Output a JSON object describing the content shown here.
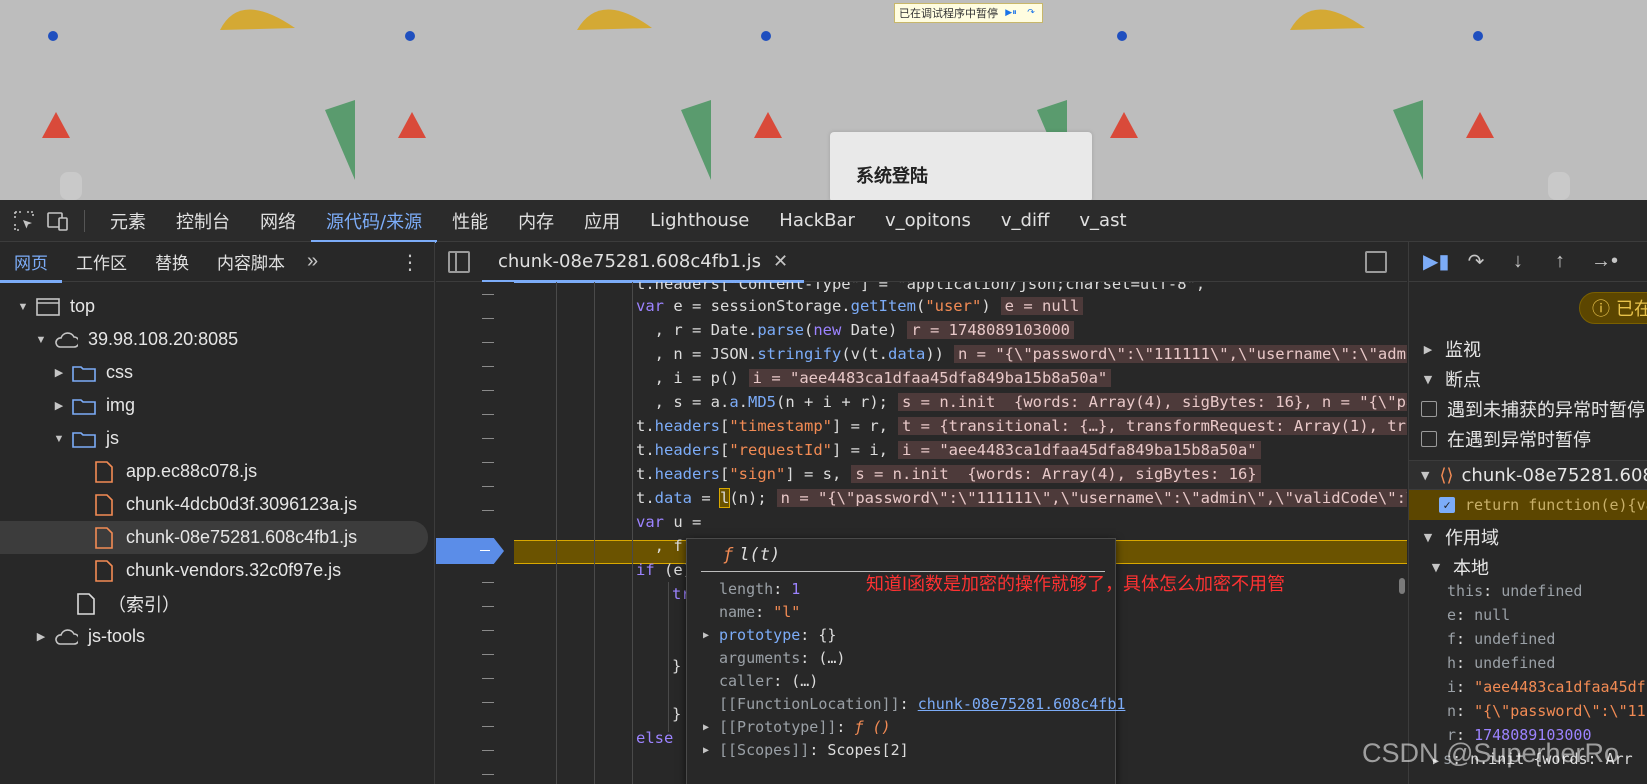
{
  "page": {
    "paused_banner": "已在调试程序中暂停",
    "login_title": "系统登陆",
    "colors": {
      "background": "#bdbdbd",
      "yellow": "#d4a934",
      "green": "#5a9b6e",
      "red": "#d94a3a",
      "blue": "#1f4fbf"
    }
  },
  "devtools": {
    "main_tabs": [
      "元素",
      "控制台",
      "网络",
      "源代码/来源",
      "性能",
      "内存",
      "应用",
      "Lighthouse",
      "HackBar",
      "v_opitons",
      "v_diff",
      "v_ast"
    ],
    "active_main_tab": "源代码/来源",
    "left_tabs": [
      "网页",
      "工作区",
      "替换",
      "内容脚本"
    ],
    "left_more": "»",
    "tree": {
      "top": "top",
      "host": "39.98.108.20:8085",
      "css": "css",
      "img": "img",
      "js": "js",
      "files": [
        "app.ec88c078.js",
        "chunk-4dcb0d3f.3096123a.js",
        "chunk-08e75281.608c4fb1.js",
        "chunk-vendors.32c0f97e.js"
      ],
      "index": "（索引）",
      "jstools": "js-tools"
    },
    "editor": {
      "tab": "chunk-08e75281.608c4fb1.js",
      "close": "✕",
      "lines": {
        "l0": "t.headers[\"Content-Type\"] = \"application/json;charset=utf-8\",",
        "l1a": "var",
        "l1b": " e = sessionStorage.",
        "l1c": "getItem",
        "l1d": "(",
        "l1e": "\"user\"",
        "l1f": ")",
        "l1i": "e = null",
        "l2a": "  , r = Date.",
        "l2b": "parse",
        "l2c": "(",
        "l2d": "new",
        "l2e": " Date)",
        "l2i": "r = 1748089103000",
        "l3a": "  , n = JSON.",
        "l3b": "stringify",
        "l3c": "(v(t.",
        "l3d": "data",
        "l3e": "))",
        "l3i": "n = \"{\\\"password\\\":\\\"111111\\\",\\\"username\\\":\\\"admi",
        "l4a": "  , i = p()",
        "l4i": "i = \"aee4483ca1dfaa45dfa849ba15b8a50a\"",
        "l5a": "  , s = a.",
        "l5b": "a",
        "l5c": ".",
        "l5d": "MD5",
        "l5e": "(n + i + r);",
        "l5i": "s = n.init  {words: Array(4), sigBytes: 16}, n = \"{\\\"pa",
        "l6a": "t.",
        "l6b": "headers",
        "l6c": "[",
        "l6d": "\"timestamp\"",
        "l6e": "] = r,",
        "l6i": "t = {transitional: {…}, transformRequest: Array(1), tr",
        "l7a": "t.",
        "l7b": "headers",
        "l7c": "[",
        "l7d": "\"requestId\"",
        "l7e": "] = i,",
        "l7i": "i = \"aee4483ca1dfaa45dfa849ba15b8a50a\"",
        "l8a": "t.",
        "l8b": "headers",
        "l8c": "[",
        "l8d": "\"sign\"",
        "l8e": "] = s,",
        "l8i": "s = n.init  {words: Array(4), sigBytes: 16}",
        "l9a": "t.",
        "l9b": "data",
        "l9c": " = ",
        "l9d": "l",
        "l9e": "(n);",
        "l9i": "n = \"{\\\"password\\\":\\\"111111\\\",\\\"username\\\":\\\"admin\\\",\\\"validCode\\\":\\",
        "l10a": "var",
        "l10b": " u =",
        "l11a": "  , f =",
        "l12a": "if",
        "l12b": " (e)",
        "l13a": "try",
        "l16a": "} ",
        "l16b": "ca",
        "l18a": "}",
        "l19a": "else"
      }
    },
    "popover": {
      "title": "l(t)",
      "f": "ƒ",
      "rows": {
        "length_k": "length",
        "length_v": "1",
        "name_k": "name",
        "name_v": "\"l\"",
        "prototype_k": "prototype",
        "prototype_v": "{}",
        "arguments_k": "arguments",
        "arguments_v": "(…)",
        "caller_k": "caller",
        "caller_v": "(…)",
        "loc_k": "[[FunctionLocation]]",
        "loc_v": "chunk-08e75281.608c4fb1",
        "proto_k": "[[Prototype]]",
        "proto_v": "ƒ ()",
        "scopes_k": "[[Scopes]]",
        "scopes_v": "Scopes[2]"
      }
    },
    "annotation": "知道l函数是加密的操作就够了，具体怎么加密不用管",
    "right": {
      "paused": "已在",
      "watch": "监视",
      "breakpoints": "断点",
      "uncaught": "遇到未捕获的异常时暂停",
      "caught": "在遇到异常时暂停",
      "bp_file": "chunk-08e75281.608c",
      "bp_line": "return function(e){va",
      "scope": "作用域",
      "local": "本地",
      "vars": {
        "this_k": "this",
        "this_v": "undefined",
        "e_k": "e",
        "e_v": "null",
        "f_k": "f",
        "f_v": "undefined",
        "h_k": "h",
        "h_v": "undefined",
        "i_k": "i",
        "i_v": "\"aee4483ca1dfaa45df",
        "n_k": "n",
        "n_v": "\"{\\\"password\\\":\\\"11",
        "r_k": "r",
        "r_v": "1748089103000",
        "s_k": "s",
        "s_v": "n.init  {words: Arr"
      }
    },
    "watermark": "CSDN @SuperherRo"
  }
}
